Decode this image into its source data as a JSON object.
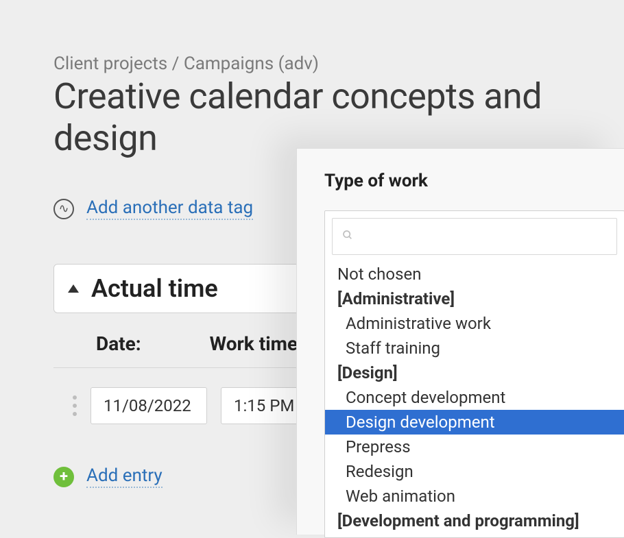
{
  "breadcrumb": "Client projects / Campaigns (adv)",
  "page_title": "Creative calendar concepts and design",
  "tag_link": "Add another data tag",
  "section": {
    "title": "Actual time",
    "columns": {
      "date": "Date:",
      "work_time": "Work time"
    }
  },
  "row": {
    "date": "11/08/2022",
    "time": "1:15 PM"
  },
  "add_entry": "Add entry",
  "popover": {
    "title": "Type of work",
    "search_placeholder": "",
    "options": {
      "not_chosen": "Not chosen",
      "group_admin": "[Administrative]",
      "admin_work": "Administrative work",
      "staff_training": "Staff training",
      "group_design": "[Design]",
      "concept_dev": "Concept development",
      "design_dev": "Design development",
      "prepress": "Prepress",
      "redesign": "Redesign",
      "web_anim": "Web animation",
      "group_dev": "[Development and programming]"
    }
  }
}
